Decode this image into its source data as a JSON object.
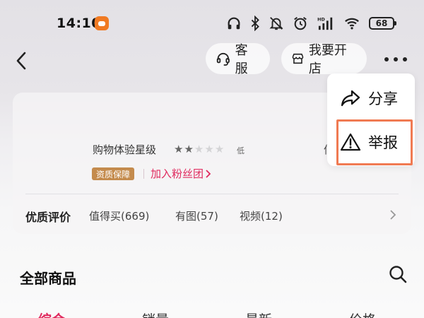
{
  "status_bar": {
    "time": "14:10",
    "battery": "68"
  },
  "nav": {
    "service_label": "客服",
    "open_shop_label": "我要开店"
  },
  "store": {
    "rating_label": "购物体验星级",
    "stars_filled": 2,
    "stars_total": 5,
    "rating_level": "低",
    "partial_text": "信",
    "badge": "资质保障",
    "fan_group_link": "加入粉丝团"
  },
  "reviews": {
    "title": "优质评价",
    "tags": [
      "值得买(669)",
      "有图(57)",
      "视频(12)"
    ]
  },
  "products": {
    "title": "全部商品",
    "sort_tabs": [
      "综合",
      "销量",
      "最新",
      "价格"
    ]
  },
  "menu": {
    "items": [
      {
        "label": "分享",
        "icon": "share-icon"
      },
      {
        "label": "举报",
        "icon": "warning-icon"
      }
    ],
    "highlight_color": "#f07a52"
  },
  "colors": {
    "accent": "#e02a5e",
    "badge": "#c48b4d"
  }
}
